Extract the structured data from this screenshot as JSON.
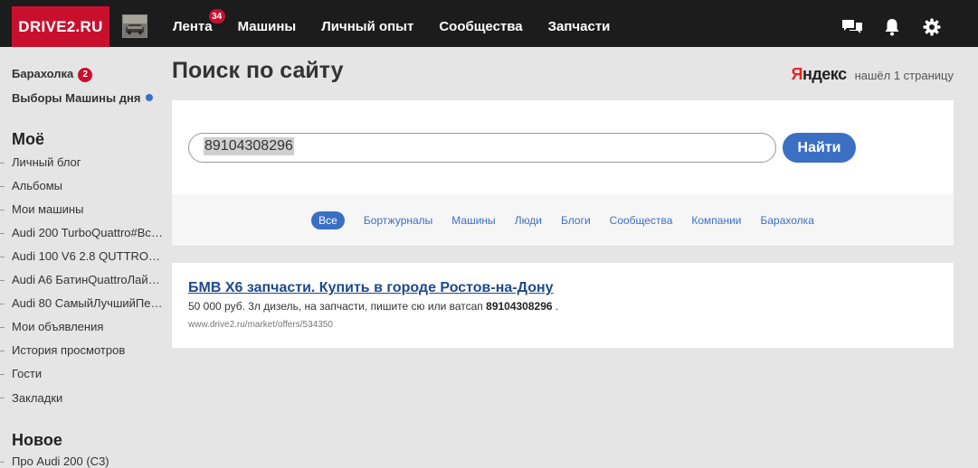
{
  "header": {
    "logo": "DRIVE2.RU",
    "nav": [
      {
        "label": "Лента",
        "badge": "34"
      },
      {
        "label": "Машины"
      },
      {
        "label": "Личный опыт"
      },
      {
        "label": "Сообщества"
      },
      {
        "label": "Запчасти"
      }
    ],
    "icons": [
      "messages-icon",
      "bell-icon",
      "gear-icon"
    ]
  },
  "sidebar": {
    "top_items": [
      {
        "label": "Барахолка",
        "badge": "2"
      },
      {
        "label": "Выборы Машины дня"
      }
    ],
    "my_heading": "Моё",
    "my_items": [
      "Личный блог",
      "Альбомы",
      "Мои машины",
      "Audi 200 TurboQuattro#Всё…",
      "Audi 100 V6 2.8 QUTTRO-…",
      "Audi A6 БатинQuattroЛайн…",
      "Audi 80 СамыйЛучшийПе…",
      "Мои объявления",
      "История просмотров",
      "Гости",
      "Закладки"
    ],
    "new_heading": "Новое",
    "new_items": [
      "Про Audi 200 (C3)"
    ]
  },
  "main": {
    "title": "Поиск по сайту",
    "yandex_logo_first": "Я",
    "yandex_logo_rest": "ндекс",
    "found_text": "нашёл 1 страницу",
    "search": {
      "value": "89104308296",
      "button_label": "Найти"
    },
    "filters": [
      "Все",
      "Бортжурналы",
      "Машины",
      "Люди",
      "Блоги",
      "Сообщества",
      "Компании",
      "Барахолка"
    ],
    "active_filter": "Все",
    "result": {
      "title": "БМВ Х6 запчасти. Купить в городе Ростов-на-Дону",
      "snippet_text": "50 000 руб. 3л дизель, на запчасти, пишите сю или ватсап ",
      "snippet_bold": "89104308296",
      "snippet_end": " .",
      "url": "www.drive2.ru/market/offers/534350"
    }
  },
  "colors": {
    "brand_red": "#c8102e",
    "accent_blue": "#3a6fc4",
    "link_dark_blue": "#1e4a8c"
  }
}
